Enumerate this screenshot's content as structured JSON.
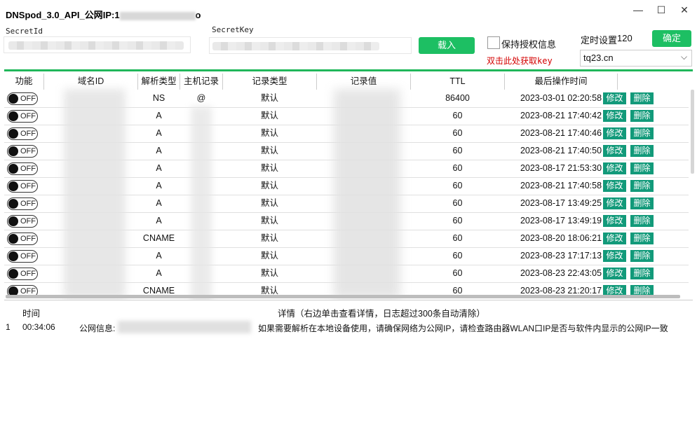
{
  "window": {
    "title": "DNSpod_3.0_API_公网IP:1",
    "title_suffix": "o",
    "minimize": "—",
    "maximize": "☐",
    "close": "✕"
  },
  "settings": {
    "secret_id_label": "SecretId",
    "secret_key_label": "SecretKey",
    "load_button": "载入",
    "keep_auth_label": "保持授权信息",
    "get_key_link": "双击此处获取key",
    "timer_label": "定时设置",
    "timer_value": "120",
    "confirm_button": "确定",
    "domain_select": "tq23.cn"
  },
  "table": {
    "headers": [
      "功能",
      "域名ID",
      "解析类型",
      "主机记录",
      "记录类型",
      "记录值",
      "TTL",
      "最后操作时间"
    ],
    "toggle_label": "OFF",
    "edit_label": "修改",
    "delete_label": "删除",
    "rows": [
      {
        "type": "NS",
        "host": "@",
        "record_type": "默认",
        "ttl": "86400",
        "time": "2023-03-01 02:20:58"
      },
      {
        "type": "A",
        "host": "",
        "record_type": "默认",
        "ttl": "60",
        "time": "2023-08-21 17:40:42"
      },
      {
        "type": "A",
        "host": "",
        "record_type": "默认",
        "ttl": "60",
        "time": "2023-08-21 17:40:46"
      },
      {
        "type": "A",
        "host": "",
        "record_type": "默认",
        "ttl": "60",
        "time": "2023-08-21 17:40:50"
      },
      {
        "type": "A",
        "host": "",
        "record_type": "默认",
        "ttl": "60",
        "time": "2023-08-17 21:53:30"
      },
      {
        "type": "A",
        "host": "",
        "record_type": "默认",
        "ttl": "60",
        "time": "2023-08-21 17:40:58"
      },
      {
        "type": "A",
        "host": "",
        "record_type": "默认",
        "ttl": "60",
        "time": "2023-08-17 13:49:25"
      },
      {
        "type": "A",
        "host": "",
        "record_type": "默认",
        "ttl": "60",
        "time": "2023-08-17 13:49:19"
      },
      {
        "type": "CNAME",
        "host": "",
        "record_type": "默认",
        "ttl": "60",
        "time": "2023-08-20 18:06:21"
      },
      {
        "type": "A",
        "host": "",
        "record_type": "默认",
        "ttl": "60",
        "time": "2023-08-23 17:17:13"
      },
      {
        "type": "A",
        "host": "",
        "record_type": "默认",
        "ttl": "60",
        "time": "2023-08-23 22:43:05"
      },
      {
        "type": "CNAME",
        "host": "",
        "record_type": "默认",
        "ttl": "60",
        "time": "2023-08-23 21:20:17"
      }
    ]
  },
  "log": {
    "time_header": "时间",
    "detail_header": "详情（右边单击查看详情，日志超过300条自动清除）",
    "entries": [
      {
        "index": "1",
        "time": "00:34:06",
        "detail_prefix": "公网信息:",
        "detail": "如果需要解析在本地设备使用，请确保网络为公网IP，请检查路由器WLAN口IP是否与软件内显示的公网IP一致"
      }
    ]
  },
  "colors": {
    "accent_green": "#1dbf63",
    "action_teal": "#129a7a",
    "link_red": "#d40000"
  }
}
